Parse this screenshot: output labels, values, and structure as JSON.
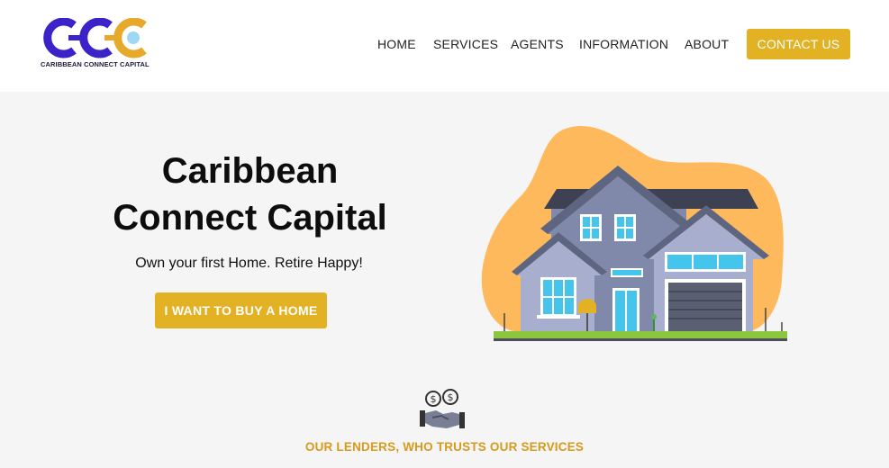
{
  "brand": {
    "name": "CARIBBEAN CONNECT CAPITAL",
    "logo_letters": "CCC",
    "colors": {
      "purple": "#3c22c9",
      "gold": "#e6a92a",
      "light_blue": "#9fd8f5"
    }
  },
  "nav": {
    "items": [
      "HOME",
      "SERVICES",
      "AGENTS",
      "INFORMATION",
      "ABOUT"
    ],
    "contact_label": "CONTACT US"
  },
  "hero": {
    "title_line1": "Caribbean",
    "title_line2": "Connect Capital",
    "subtitle": "Own your first Home. Retire Happy!",
    "cta_label": "I WANT TO BUY A HOME",
    "illustration_icon": "house-illustration"
  },
  "lenders": {
    "icon": "handshake-money-icon",
    "title": "OUR LENDERS, WHO TRUSTS OUR SERVICES"
  },
  "colors": {
    "accent": "#e2b224",
    "lenders_title": "#d89a1b",
    "background": "#f5f5f5",
    "header_bg": "#ffffff"
  }
}
